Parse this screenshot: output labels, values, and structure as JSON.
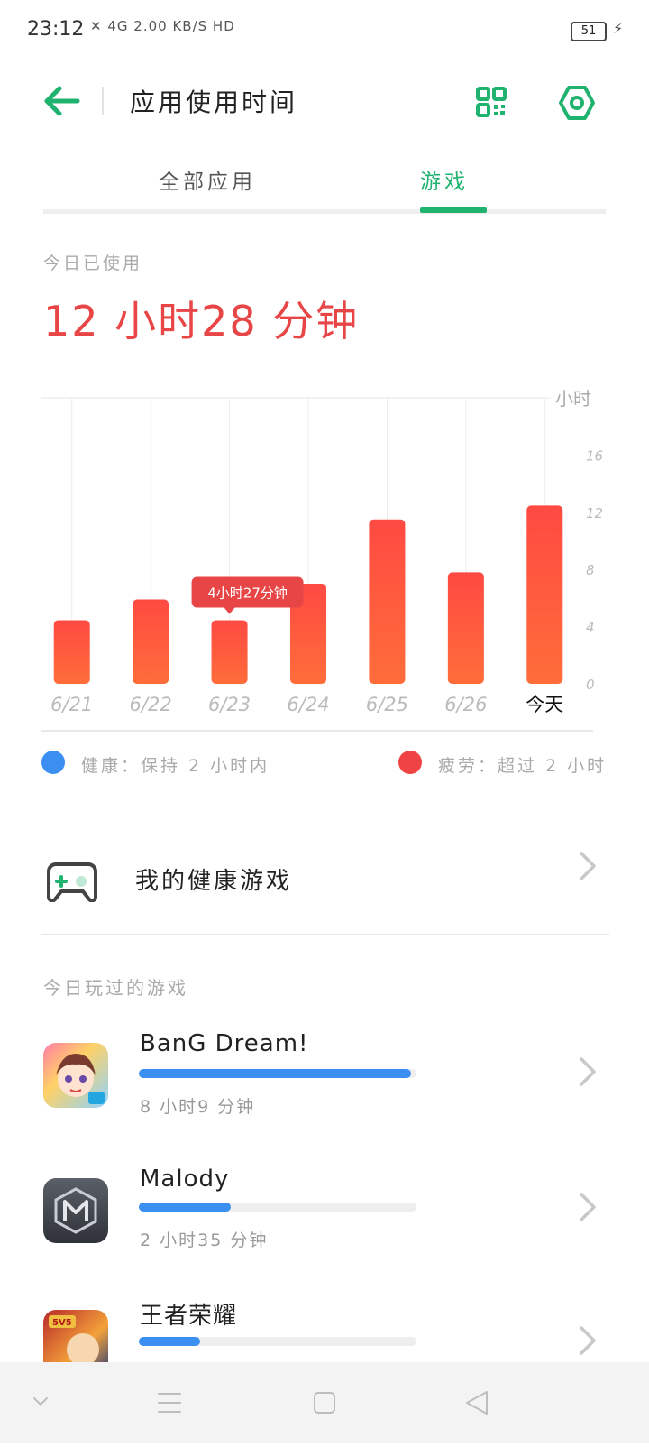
{
  "status_bar": {
    "time": "23:12",
    "network_indicators": "✕ 4G 2.00 KB/S HD",
    "battery": "51"
  },
  "app_bar": {
    "title": "应用使用时间",
    "back_icon": "back-arrow-icon",
    "qr_icon": "qr-code-icon",
    "settings_icon": "settings-icon",
    "accent_color": "#20b26f"
  },
  "tabs": [
    {
      "label": "全部应用",
      "active": false
    },
    {
      "label": "游戏",
      "active": true
    }
  ],
  "summary": {
    "label": "今日已使用",
    "value": "12 小时28 分钟",
    "value_color": "#e84646"
  },
  "chart_data": {
    "type": "bar",
    "categories": [
      "6/21",
      "6/22",
      "6/23",
      "6/24",
      "6/25",
      "6/26",
      "今天"
    ],
    "values": [
      4.45,
      5.9,
      4.45,
      7.0,
      11.5,
      7.8,
      12.47
    ],
    "unit_label": "小时",
    "yticks": [
      0,
      4,
      8,
      12,
      16
    ],
    "ylim": [
      0,
      20
    ],
    "tooltip": {
      "category": "6/23",
      "text": "4小时27分钟"
    },
    "bar_color": "#ff4a42",
    "bar_gradient_end": "#ff6d3a",
    "grid": true
  },
  "legend": [
    {
      "label": "健康：保持 2 小时内",
      "color": "#3a8ff0"
    },
    {
      "label": "疲劳：超过 2 小时",
      "color": "#f04444"
    }
  ],
  "healthy_games": {
    "label": "我的健康游戏",
    "icon": "gamepad-icon"
  },
  "played_today": {
    "label": "今日玩过的游戏",
    "games": [
      {
        "name": "BanG Dream!",
        "time": "8 小时9 分钟",
        "progress": 0.98,
        "icon": "bang-dream-app-icon"
      },
      {
        "name": "Malody",
        "time": "2 小时35 分钟",
        "progress": 0.33,
        "icon": "malody-app-icon"
      },
      {
        "name": "王者荣耀",
        "time": "",
        "progress": 0.22,
        "icon": "honor-of-kings-app-icon"
      }
    ]
  },
  "nav_bar": {
    "keys": [
      "chevron-down-icon",
      "menu-icon",
      "home-square-icon",
      "back-triangle-icon"
    ]
  }
}
